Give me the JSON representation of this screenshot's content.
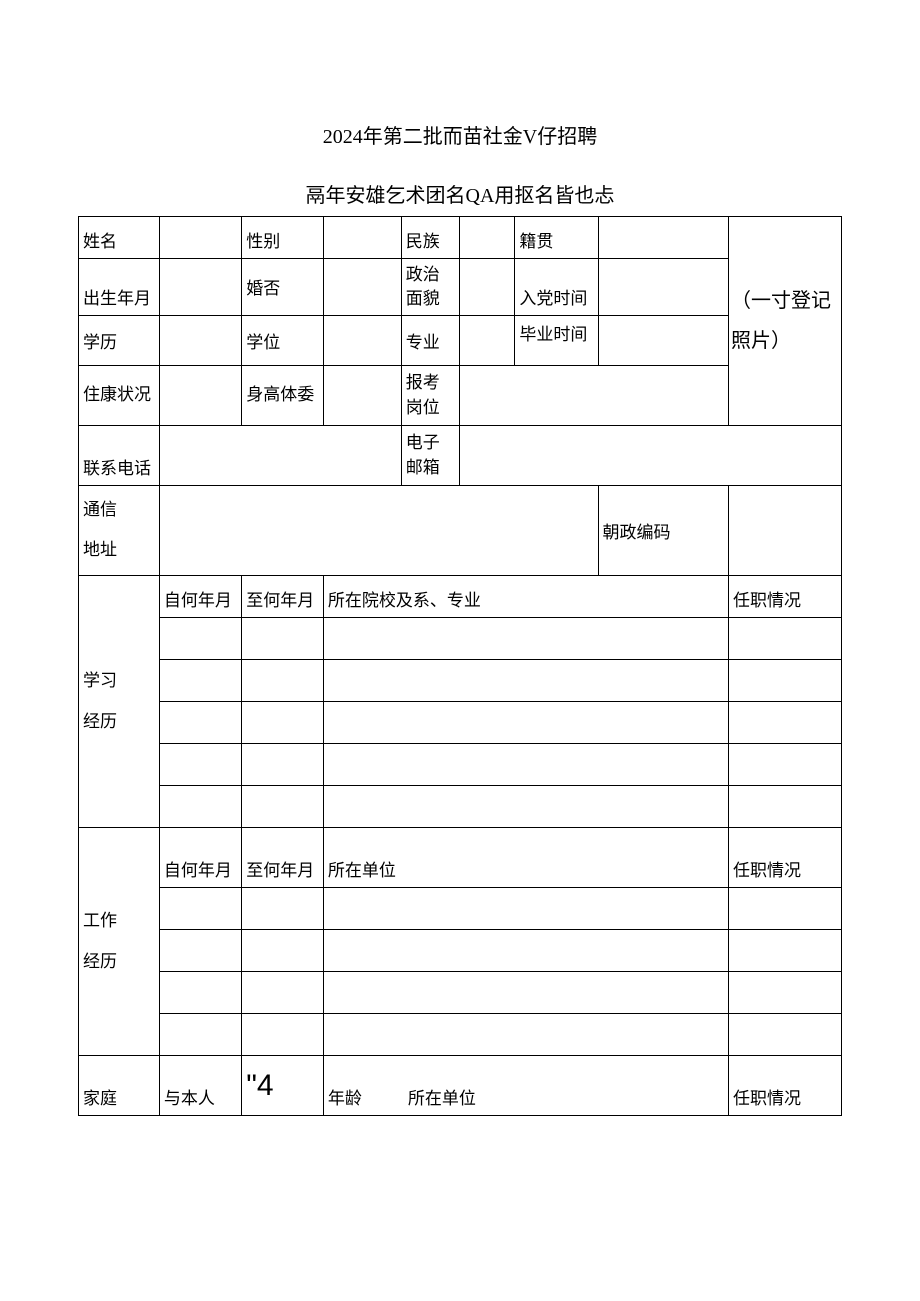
{
  "title": "2024年第二批而苗社金V仔招聘",
  "subtitle": "鬲年安雄乞术团名QA用抠名皆也忐",
  "labels": {
    "name": "姓名",
    "gender": "性别",
    "ethnicity": "民族",
    "nativePlace": "籍贯",
    "birthDate": "出生年月",
    "maritalStatus": "婚否",
    "politicalStatus": "政治面貌",
    "partyJoinDate": "入党时间",
    "education": "学历",
    "degree": "学位",
    "major": "专业",
    "graduationDate": "毕业时间",
    "healthStatus": "住康状况",
    "heightBuild": "身高体委",
    "applyPosition": "报考岗位",
    "contactPhone": "联系电话",
    "email": "电子邮箱",
    "mailingAddress": "通信地址",
    "postalCode": "朝政编码",
    "photoNote": "（一寸登记\n照片）",
    "studyHistory": "学习经历",
    "workHistory": "工作经历",
    "family": "家庭",
    "fromDate": "自何年月",
    "toDate": "至何年月",
    "schoolMajor": "所在院校及系、专业",
    "workUnit": "所在单位",
    "positionStatus": "任职情况",
    "withSelf": "与本人",
    "quote4": "\"4",
    "age": "年龄",
    "unit": "所在单位"
  }
}
